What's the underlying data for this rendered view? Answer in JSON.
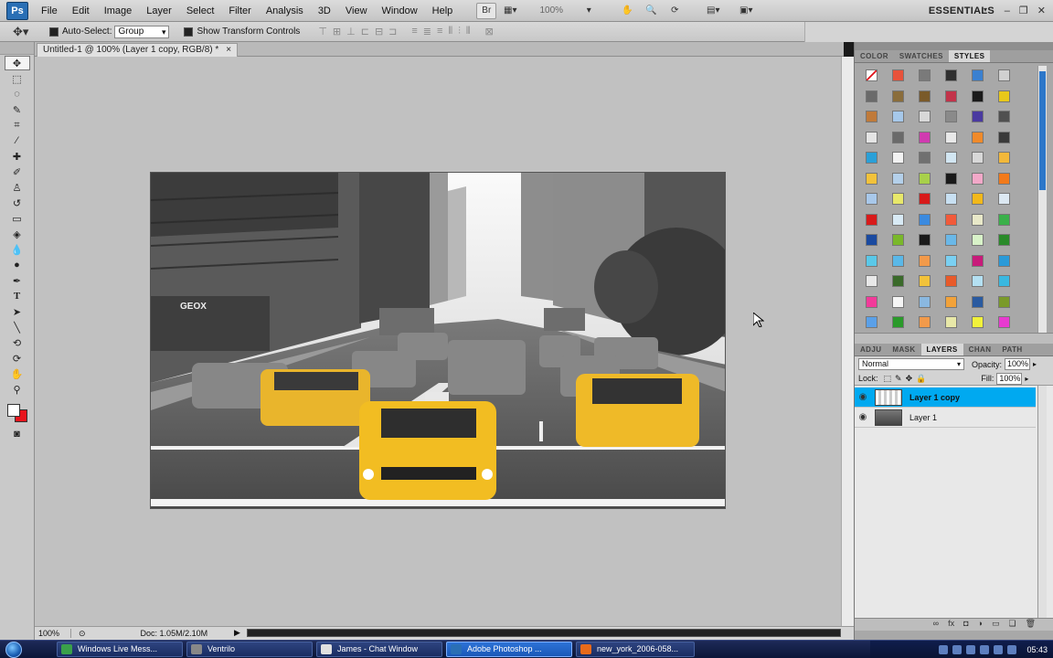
{
  "app": {
    "logo": "Ps",
    "menus": [
      "File",
      "Edit",
      "Image",
      "Layer",
      "Select",
      "Filter",
      "Analysis",
      "3D",
      "View",
      "Window",
      "Help"
    ],
    "zoom": "100%",
    "workspace": "ESSENTIALS"
  },
  "options": {
    "auto_select_label": "Auto-Select:",
    "auto_select_value": "Group",
    "transform_label": "Show Transform Controls"
  },
  "document": {
    "tab_title": "Untitled-1 @ 100% (Layer 1 copy, RGB/8) *",
    "close": "×"
  },
  "status": {
    "zoom": "100%",
    "doc": "Doc: 1.05M/2.10M"
  },
  "panels": {
    "top_tabs": [
      "COLOR",
      "SWATCHES",
      "STYLES"
    ],
    "top_active": "STYLES",
    "styles": [
      "#ffffff",
      "#e8523a",
      "#7a7a7a",
      "#2f2f2f",
      "#3a80d0",
      "#d0d0d0",
      "#6a6a6a",
      "#8a6d3b",
      "#7a5a2a",
      "#c2334a",
      "#1a1a1a",
      "#e8c81a",
      "#c07a3a",
      "#a6c8ea",
      "#d8d8d8",
      "#8a8a8a",
      "#4a3aa0",
      "#505050",
      "#e4e4e4",
      "#6a6a6a",
      "#d03ab0",
      "#e8e8e8",
      "#f08a2a",
      "#3a3a3a",
      "#2aa0d8",
      "#f2f2f2",
      "#707070",
      "#d2e6f2",
      "#d8d8d8",
      "#f2b83a",
      "#f2c23a",
      "#b4d0ea",
      "#a8d04a",
      "#1a1a1a",
      "#f2a8c8",
      "#f27a1a",
      "#a8c8ea",
      "#e8e86a",
      "#d81a1a",
      "#c8e0f2",
      "#f2b81a",
      "#dce8f2",
      "#d81a1a",
      "#d8eaf5",
      "#3a8ae0",
      "#f25a3a",
      "#e8e8c8",
      "#3ab04a",
      "#1a4aa0",
      "#7ab82a",
      "#1a1a1a",
      "#6ab8e8",
      "#d8f2c8",
      "#2a8a2a",
      "#5ac8e8",
      "#5ab8e8",
      "#f29a4a",
      "#7ad0f2",
      "#c81a7a",
      "#2a9ad8",
      "#e8e8e8",
      "#3a6a2a",
      "#f2c23a",
      "#e85a2a",
      "#b4e0f2",
      "#3ab8e0",
      "#f23a9a",
      "#f5f5f5",
      "#8ab8e0",
      "#f2a23a",
      "#2a5aa0",
      "#7a9a2a",
      "#5aa0e8",
      "#2a9a2a",
      "#f29a4a",
      "#e8e8a8",
      "#f2f23a",
      "#e83ad0"
    ],
    "bottom_tabs": [
      "ADJU",
      "MASK",
      "LAYERS",
      "CHAN",
      "PATH"
    ],
    "bottom_active": "LAYERS",
    "blend_mode": "Normal",
    "opacity_label": "Opacity:",
    "opacity_value": "100%",
    "lock_label": "Lock:",
    "fill_label": "Fill:",
    "fill_value": "100%",
    "layers": [
      {
        "name": "Layer 1 copy",
        "selected": true
      },
      {
        "name": "Layer 1",
        "selected": false
      }
    ]
  },
  "taskbar": {
    "items": [
      {
        "label": "Windows Live Mess...",
        "icon": "#3aa04a",
        "active": false
      },
      {
        "label": "Ventrilo",
        "icon": "#888888",
        "active": false
      },
      {
        "label": "James - Chat Window",
        "icon": "#e0e0e0",
        "active": false
      },
      {
        "label": "Adobe Photoshop ...",
        "icon": "#2a6fb5",
        "active": true
      },
      {
        "label": "new_york_2006-058...",
        "icon": "#e86a1a",
        "active": false
      }
    ],
    "clock": "05:43"
  }
}
